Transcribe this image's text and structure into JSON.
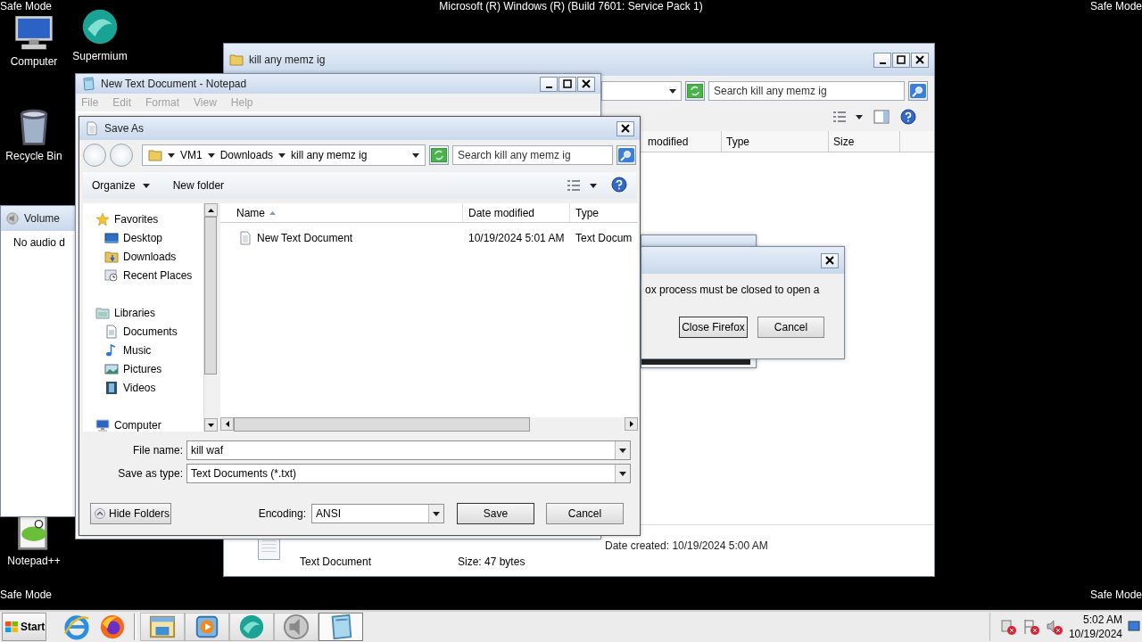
{
  "desktop": {
    "corner_labels": [
      "Safe Mode",
      "Safe Mode",
      "Safe Mode",
      "Safe Mode"
    ],
    "banner": "Microsoft (R) Windows (R) (Build 7601: Service Pack 1)",
    "icons": [
      {
        "label": "Computer",
        "kind": "computer"
      },
      {
        "label": "Supermium",
        "kind": "supermium"
      },
      {
        "label": "Recycle Bin",
        "kind": "recycle"
      },
      {
        "label": "Notepad++",
        "kind": "notepadpp"
      }
    ]
  },
  "volume_window": {
    "title": "Volume",
    "text": "No audio d"
  },
  "explorer_window": {
    "title": "kill any memz ig",
    "search": {
      "placeholder": "Search kill any memz ig"
    },
    "columns": [
      "modified",
      "Type",
      "Size"
    ],
    "details": {
      "type": "Text Document",
      "size": "Size: 47 bytes",
      "created": "Date created: 10/19/2024 5:00 AM"
    }
  },
  "firefox_dialog": {
    "message": "ox process must be closed to open a",
    "buttons": [
      "Close Firefox",
      "Cancel"
    ]
  },
  "notepad": {
    "title": "New Text Document - Notepad",
    "menu": [
      {
        "label": "File",
        "disabled": true
      },
      {
        "label": "Edit",
        "disabled": true
      },
      {
        "label": "Format",
        "disabled": true
      },
      {
        "label": "View",
        "disabled": true
      },
      {
        "label": "Help",
        "disabled": true
      }
    ]
  },
  "save_dialog": {
    "title": "Save As",
    "breadcrumb": [
      "VM1",
      "Downloads",
      "kill any memz ig"
    ],
    "search": {
      "placeholder": "Search kill any memz ig"
    },
    "toolbar": [
      "Organize",
      "New folder"
    ],
    "nav": [
      {
        "label": "Favorites",
        "kind": "star",
        "children": [
          {
            "label": "Desktop",
            "kind": "desktop"
          },
          {
            "label": "Downloads",
            "kind": "download"
          },
          {
            "label": "Recent Places",
            "kind": "recent"
          }
        ]
      },
      {
        "label": "Libraries",
        "kind": "library",
        "children": [
          {
            "label": "Documents",
            "kind": "document"
          },
          {
            "label": "Music",
            "kind": "music"
          },
          {
            "label": "Pictures",
            "kind": "pictures"
          },
          {
            "label": "Videos",
            "kind": "video"
          }
        ]
      },
      {
        "label": "Computer",
        "kind": "computer"
      }
    ],
    "columns": [
      {
        "label": "Name",
        "sorted": true
      },
      {
        "label": "Date modified",
        "sorted": false
      },
      {
        "label": "Type",
        "sorted": false
      }
    ],
    "rows": [
      {
        "name": "New Text Document",
        "date": "10/19/2024 5:01 AM",
        "type": "Text Docum"
      }
    ],
    "file_name": {
      "label": "File name:",
      "value": "kill waf"
    },
    "save_type": {
      "label": "Save as type:",
      "value": "Text Documents (*.txt)"
    },
    "hide_folders": "Hide Folders",
    "encoding": {
      "label": "Encoding:",
      "value": "ANSI"
    },
    "buttons": [
      "Save",
      "Cancel"
    ]
  },
  "taskbar": {
    "start": "Start",
    "quick_launch": [
      {
        "kind": "ie"
      },
      {
        "kind": "firefox"
      }
    ],
    "tasks": [
      {
        "kind": "explorer",
        "active": false
      },
      {
        "kind": "media",
        "active": false
      },
      {
        "kind": "supermium",
        "active": false
      },
      {
        "kind": "speaker",
        "active": false
      },
      {
        "kind": "notepad",
        "active": true
      }
    ],
    "clock": {
      "time": "5:02 AM",
      "date": "10/19/2024"
    }
  }
}
